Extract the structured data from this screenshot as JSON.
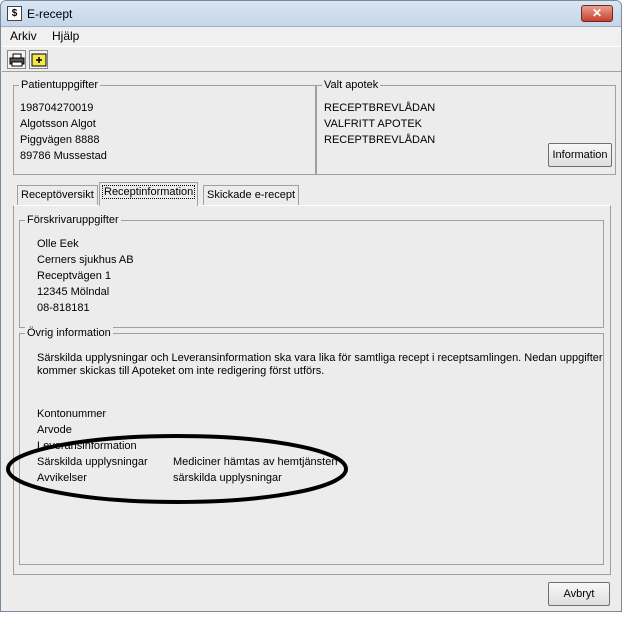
{
  "window": {
    "title": "E-recept",
    "close_glyph": "✕"
  },
  "menu": {
    "items": [
      "Arkiv",
      "Hjälp"
    ]
  },
  "toolbar": {
    "icons": [
      "printer-icon",
      "new-document-icon"
    ]
  },
  "patient": {
    "legend": "Patientuppgifter",
    "lines": [
      "198704270019",
      "Algotsson Algot",
      "Piggvägen 8888",
      "89786 Mussestad"
    ]
  },
  "pharmacy": {
    "legend": "Valt apotek",
    "lines": [
      "RECEPTBREVLÅDAN",
      "VALFRITT APOTEK",
      "RECEPTBREVLÅDAN"
    ],
    "info_button": "Information"
  },
  "tabs": [
    {
      "label": "Receptöversikt",
      "active": false
    },
    {
      "label": "Receptinformation",
      "active": true
    },
    {
      "label": "Skickade e-recept",
      "active": false
    }
  ],
  "prescriber": {
    "legend": "Förskrivaruppgifter",
    "lines": [
      "Olle Eek",
      "Cerners sjukhus AB",
      "Receptvägen 1",
      "12345 Mölndal",
      "08-818181"
    ]
  },
  "other": {
    "legend": "Övrig information",
    "notice_line1": "Särskilda upplysningar och Leveransinformation ska vara lika för samtliga recept i receptsamlingen. Nedan uppgifter",
    "notice_line2": "kommer skickas till Apoteket om inte redigering först utförs.",
    "rows": [
      {
        "label": "Kontonummer",
        "value": ""
      },
      {
        "label": "Arvode",
        "value": ""
      },
      {
        "label": "Leveransinformation",
        "value": ""
      },
      {
        "label": "Särskilda upplysningar",
        "value": "Mediciner hämtas av hemtjänsten"
      },
      {
        "label": "Avvikelser",
        "value": "särskilda upplysningar"
      }
    ]
  },
  "footer": {
    "cancel_button": "Avbryt"
  },
  "colors": {
    "title_gradient_top": "#d9e6f4",
    "close_button": "#c8412b",
    "annotation_ellipse": "#000000"
  }
}
